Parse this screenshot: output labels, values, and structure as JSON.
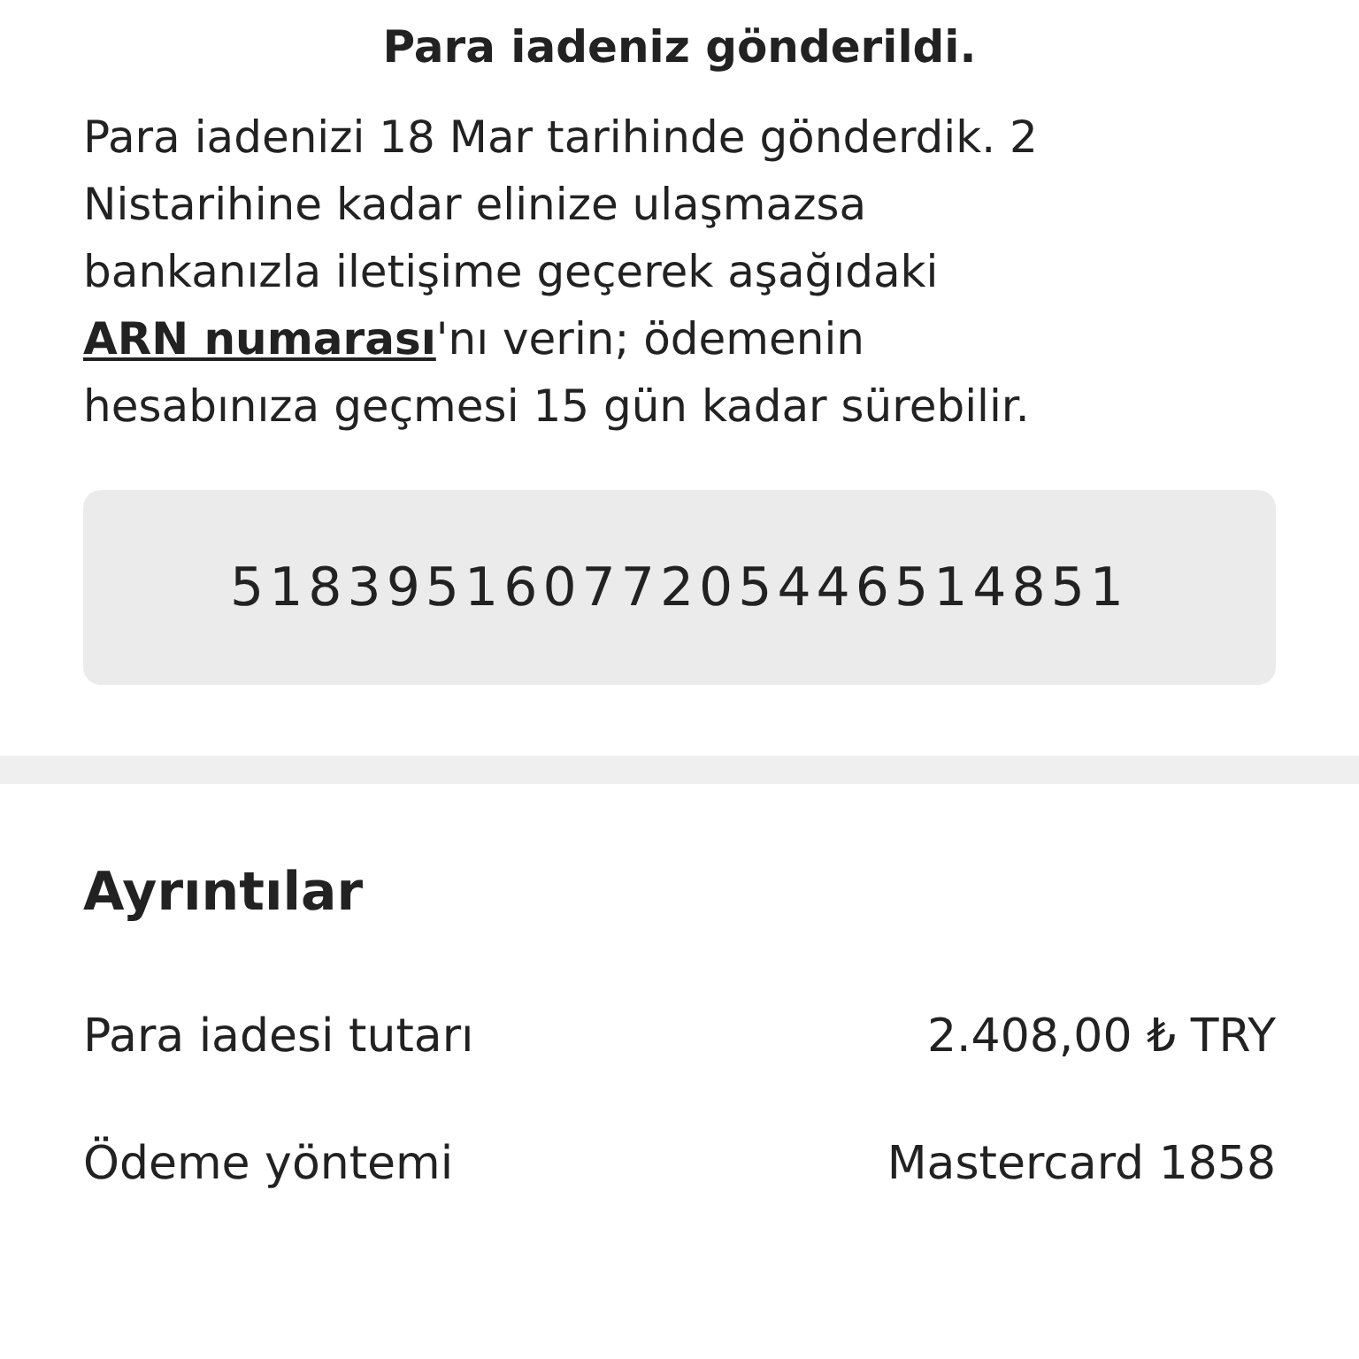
{
  "heading": "Para iadeniz gönderildi.",
  "message": {
    "before": "Para iadenizi 18 Mar tarihinde gönderdik. 2 Nistarihine kadar elinize ulaşmazsa bankanızla iletişime geçerek aşağıdaki ",
    "link": "ARN numarası",
    "after": "'nı verin; ödemenin hesabınıza geçmesi 15 gün kadar sürebilir."
  },
  "arn": "51839516077205446514851",
  "details": {
    "title": "Ayrıntılar",
    "rows": [
      {
        "label": "Para iadesi tutarı",
        "value": "2.408,00 ₺ TRY"
      },
      {
        "label": "Ödeme yöntemi",
        "value": "Mastercard 1858"
      }
    ]
  }
}
